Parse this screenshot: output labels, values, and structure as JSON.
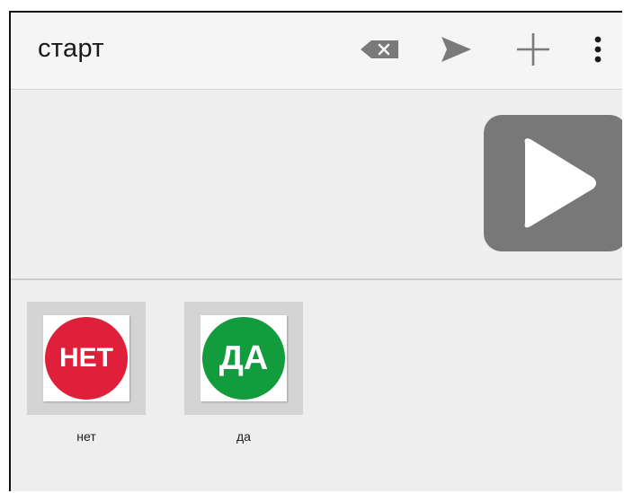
{
  "header": {
    "title": "старт",
    "clear_icon": "backspace-clear-icon",
    "send_icon": "send-icon",
    "add_icon": "add-icon",
    "more_icon": "more-vert-icon"
  },
  "message_bar": {
    "play_icon": "play-icon"
  },
  "symbols": [
    {
      "label": "нет",
      "image_text": "НЕТ",
      "color": "#e0203a"
    },
    {
      "label": "да",
      "image_text": "ДА",
      "color": "#129c3e"
    }
  ],
  "colors": {
    "toolbar_icon": "#7a7a7a",
    "play_button": "#787878"
  }
}
